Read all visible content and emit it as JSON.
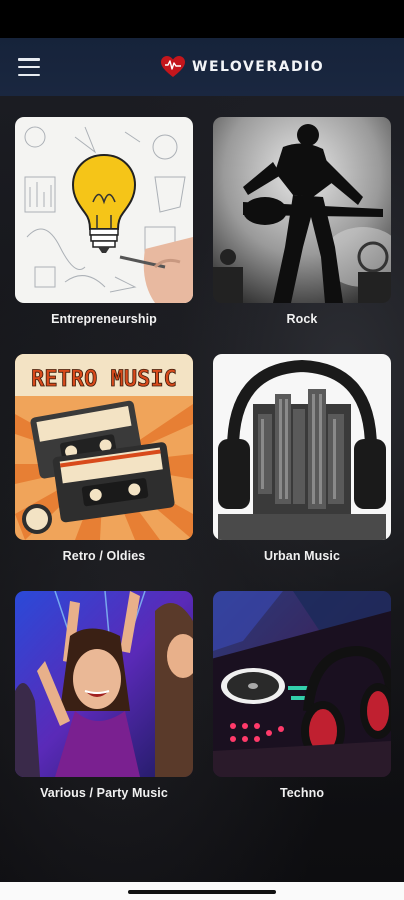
{
  "app": {
    "logo_text": "WELOVERADIO"
  },
  "icons": {
    "menu": "hamburger-menu-icon",
    "logo": "heart-logo-icon"
  },
  "colors": {
    "app_bar": "#1a2740",
    "logo_heart": "#c4161c",
    "label_text": "#f1f1f1"
  },
  "categories": [
    {
      "label": "Entrepreneurship",
      "image": "lightbulb-sketch"
    },
    {
      "label": "Rock",
      "image": "guitarist-silhouette"
    },
    {
      "label": "Retro / Oldies",
      "image": "retro-music-cassettes",
      "image_text": "RETRO MUSIC"
    },
    {
      "label": "Urban Music",
      "image": "city-headphones"
    },
    {
      "label": "Various / Party Music",
      "image": "party-crowd"
    },
    {
      "label": "Techno",
      "image": "dj-turntable"
    }
  ]
}
